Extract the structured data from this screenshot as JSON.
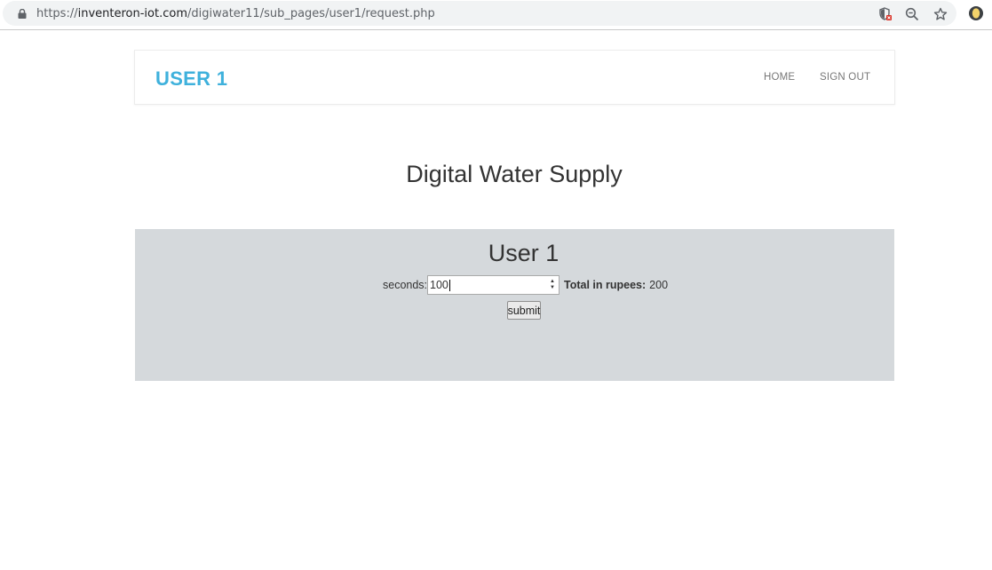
{
  "browser": {
    "url_scheme": "https://",
    "url_host": "inventeron-iot.com",
    "url_path": "/digiwater11/sub_pages/user1/request.php",
    "icons": [
      "lock-icon",
      "shield-blocked-icon",
      "zoom-icon",
      "star-icon",
      "extension-icon"
    ]
  },
  "nav": {
    "brand": "USER 1",
    "links": [
      "HOME",
      "SIGN OUT"
    ]
  },
  "main": {
    "title": "Digital Water Supply",
    "panel": {
      "heading": "User 1",
      "seconds_label": "seconds:",
      "seconds_value": "100",
      "total_label": "Total in rupees:",
      "total_value": "200",
      "submit_label": "submit"
    }
  },
  "colors": {
    "brand": "#3fb1dc",
    "panel_bg": "#d5d9dc",
    "nav_link": "#777777"
  }
}
